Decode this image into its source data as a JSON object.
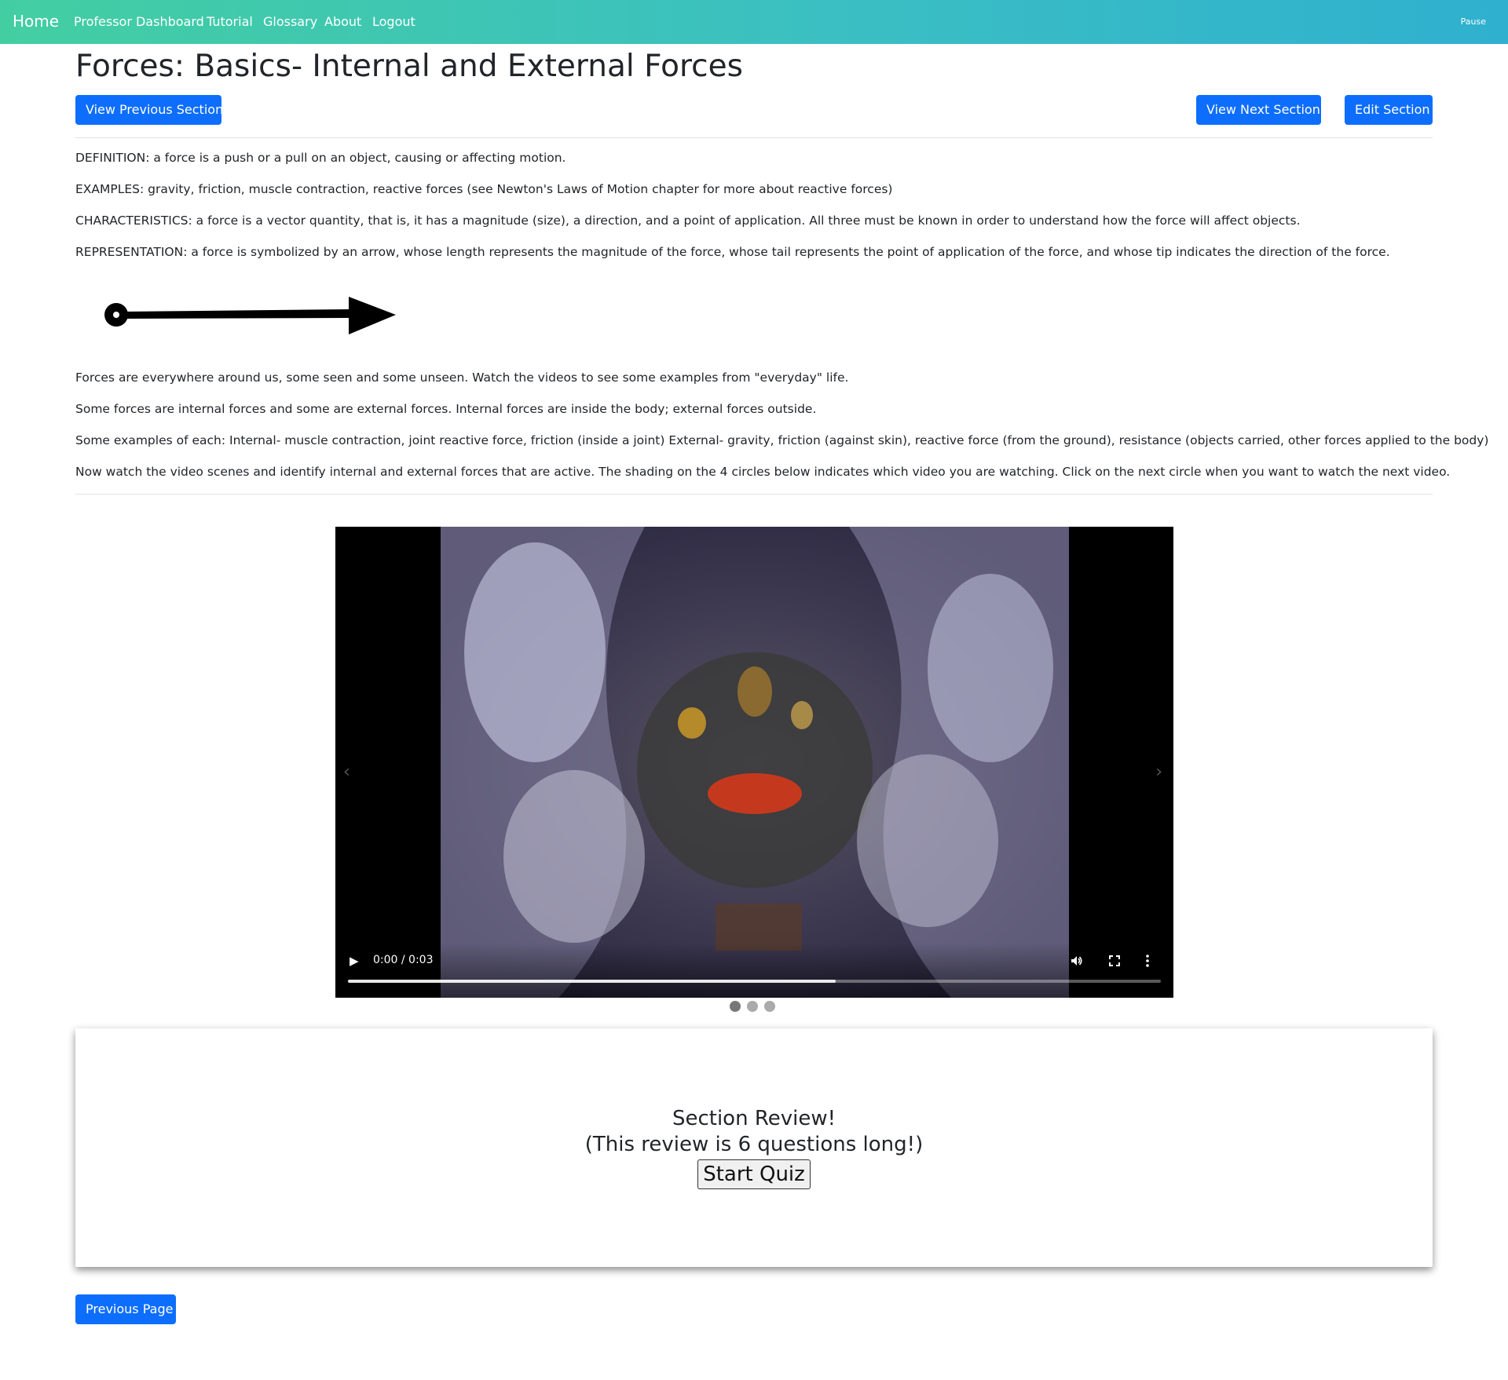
{
  "navbar": {
    "brand": "Home",
    "links": [
      "Professor Dashboard",
      "Tutorial",
      "Glossary",
      "About",
      "Logout"
    ],
    "pause": "Pause"
  },
  "page": {
    "title": "Forces: Basics- Internal and External Forces",
    "prev_section": "View Previous Section",
    "next_section": "View Next Section",
    "edit_section": "Edit Section"
  },
  "content": {
    "paragraphs": [
      "DEFINITION: a force is a push or a pull on an object, causing or affecting motion.",
      "EXAMPLES: gravity, friction, muscle contraction, reactive forces (see Newton's Laws of Motion chapter for more about reactive forces)",
      "CHARACTERISTICS: a force is a vector quantity, that is, it has a magnitude (size), a direction, and a point of application. All three must be known in order to understand how the force will affect objects.",
      "REPRESENTATION: a force is symbolized by an arrow, whose length represents the magnitude of the force, whose tail represents the point of application of the force, and whose tip indicates the direction of the force."
    ],
    "paragraphs_after": [
      "Forces are everywhere around us, some seen and some unseen. Watch the videos to see some examples from \"everyday\" life.",
      "Some forces are internal forces and some are external forces. Internal forces are inside the body; external forces outside.",
      "Some examples of each: Internal- muscle contraction, joint reactive force, friction (inside a joint) External- gravity, friction (against skin), reactive force (from the ground), resistance (objects carried, other forces applied to the body)",
      "Now watch the video scenes and identify internal and external forces that are active. The shading on the 4 circles below indicates which video you are watching. Click on the next circle when you want to watch the next video."
    ]
  },
  "video": {
    "time": "0:00 / 0:03",
    "progress_fraction": 0.6,
    "slides": 3,
    "active_slide": 0,
    "prev_icon": "chevron-left-icon",
    "next_icon": "chevron-right-icon"
  },
  "review": {
    "title": "Section Review!",
    "subtitle": "(This review is 6 questions long!)",
    "start": "Start Quiz"
  },
  "footer": {
    "previous_page": "Previous Page"
  },
  "colors": {
    "primary": "#0d6efd",
    "nav_gradient_start": "#43cea2",
    "nav_gradient_end": "#2fb0cf"
  }
}
